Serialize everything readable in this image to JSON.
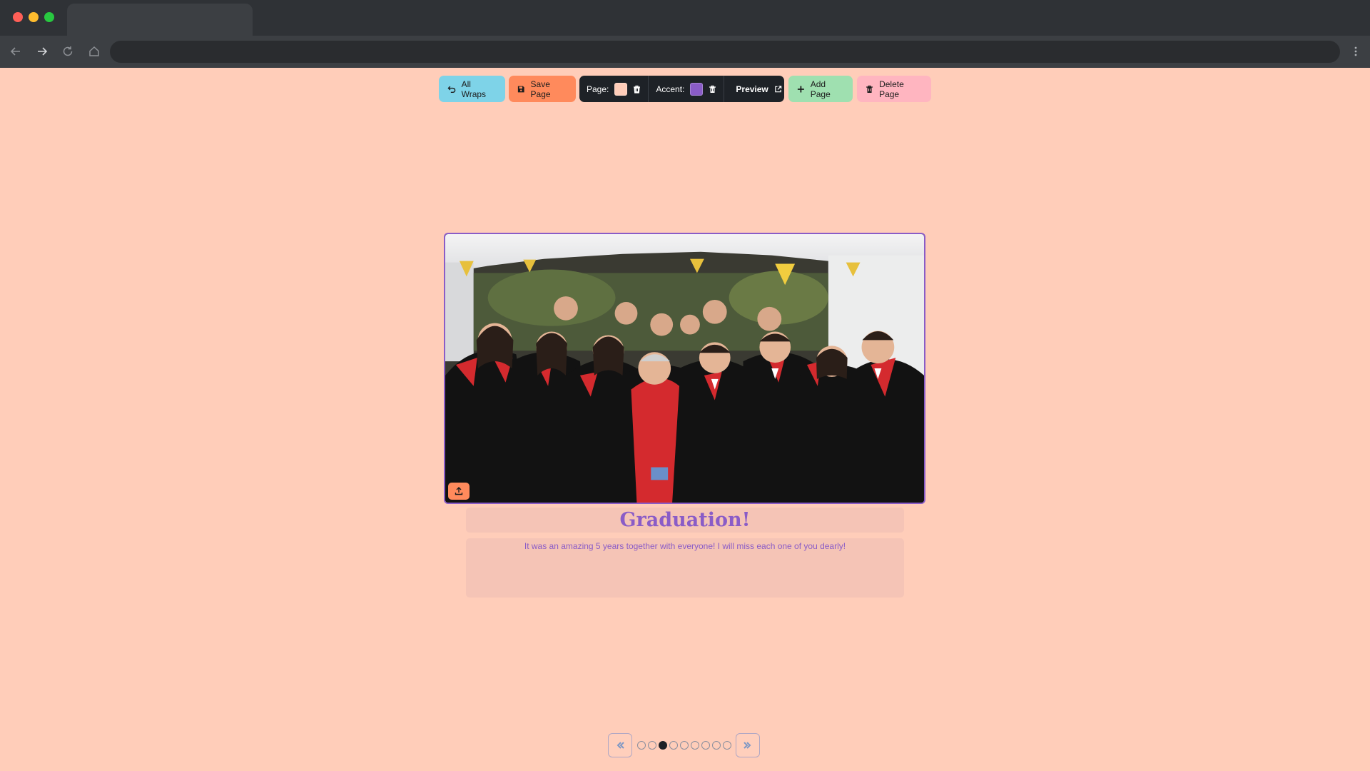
{
  "browser": {
    "tab_title": "",
    "url": ""
  },
  "toolbar": {
    "all_wraps_label": "All Wraps",
    "save_label": "Save Page",
    "page_color_label": "Page:",
    "page_color": "#ffcdb9",
    "accent_color_label": "Accent:",
    "accent_color": "#8a5cc7",
    "preview_label": "Preview",
    "add_page_label": "Add Page",
    "delete_page_label": "Delete Page"
  },
  "page": {
    "title": "Graduation!",
    "description": "It was an amazing 5 years together with everyone! I will miss each one of you dearly!",
    "photo_alt": "group photo"
  },
  "pager": {
    "total_pages": 9,
    "current_page": 3
  },
  "colors": {
    "background": "#ffcdb9",
    "accent": "#8a5cc7",
    "save": "#ff8a5c",
    "all_wraps": "#7ed3e8",
    "add": "#9fe0b0",
    "delete": "#ffb5c0",
    "dark": "#1e2227"
  }
}
